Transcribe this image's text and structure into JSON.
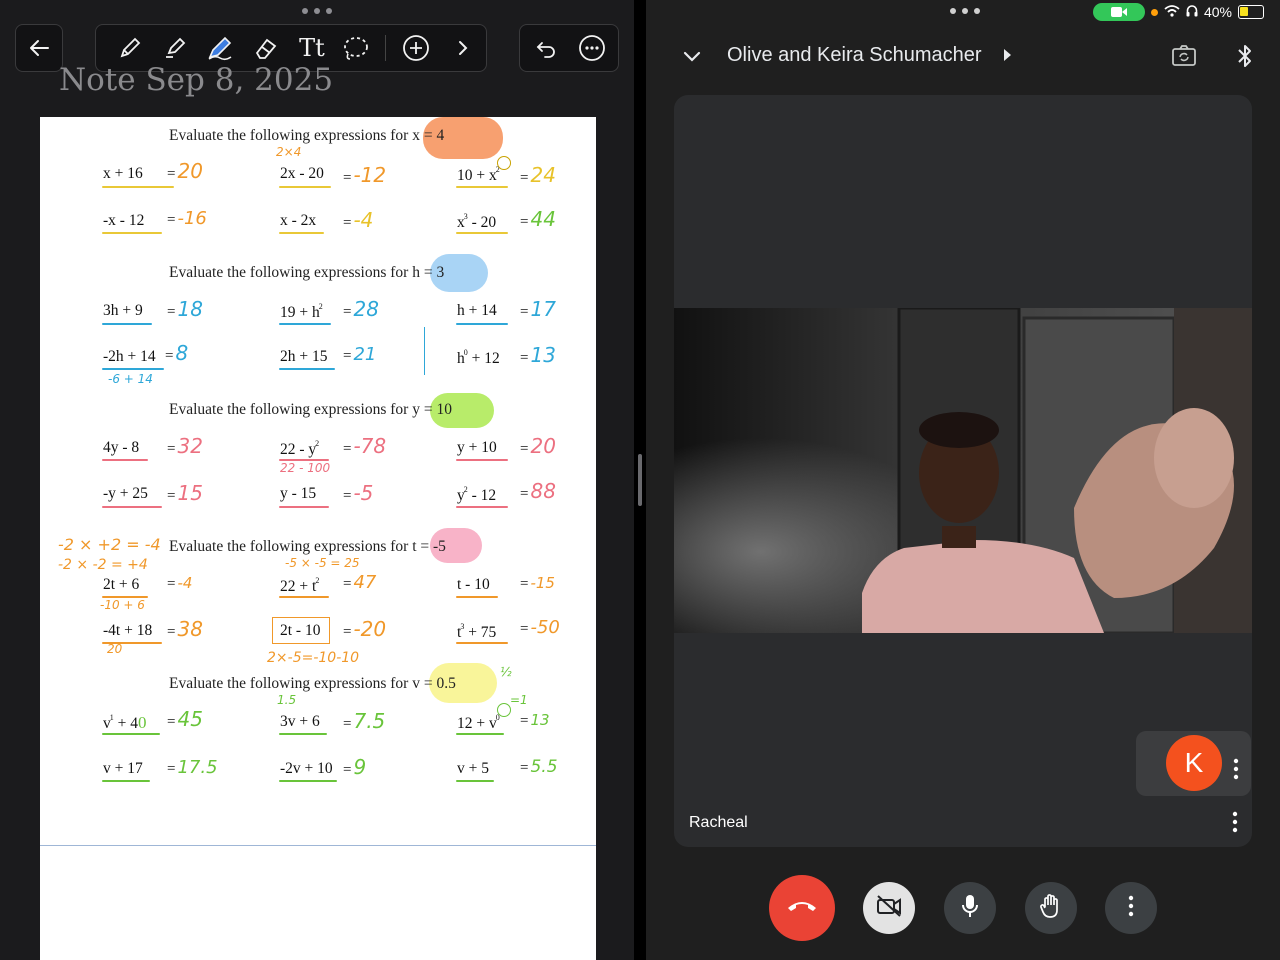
{
  "notes_app": {
    "note_title": "Note Sep 8, 2025",
    "toolbar": {
      "back_icon": "arrow-left-icon",
      "tools": [
        "pen-icon",
        "highlighter-icon",
        "pen-selected-icon",
        "eraser-icon",
        "text-icon",
        "lasso-icon",
        "add-icon",
        "chevron-right-icon"
      ],
      "text_tool_label": "Tt",
      "actions": [
        "undo-icon",
        "more-icon"
      ]
    },
    "worksheet": {
      "sections": [
        {
          "heading": "Evaluate the following expressions for ",
          "variable": "x = 4",
          "highlight": "#f7a070",
          "items": [
            {
              "expr": "x + 16",
              "sup": "",
              "answer": "20"
            },
            {
              "expr": "2x - 20",
              "sup": "",
              "answer": "-12"
            },
            {
              "expr": "10 + x",
              "sup": "2",
              "answer": "24"
            },
            {
              "expr": "-x - 12",
              "sup": "",
              "answer": "-16"
            },
            {
              "expr": "x - 2x",
              "sup": "",
              "answer": "-4"
            },
            {
              "expr": "x",
              "sup": "3",
              "expr_tail": " - 20",
              "answer": "44"
            }
          ]
        },
        {
          "heading": "Evaluate the following expressions for ",
          "variable": "h = 3",
          "highlight": "#a9d4f5",
          "items": [
            {
              "expr": "3h + 9",
              "sup": "",
              "answer": "18"
            },
            {
              "expr": "19 + h",
              "sup": "2",
              "answer": "28"
            },
            {
              "expr": "h + 14",
              "sup": "",
              "answer": "17"
            },
            {
              "expr": "-2h + 14",
              "sup": "",
              "answer": "8"
            },
            {
              "expr": "2h + 15",
              "sup": "",
              "answer": "21"
            },
            {
              "expr": "h",
              "sup": "0",
              "expr_tail": " + 12",
              "answer": "13"
            }
          ]
        },
        {
          "heading": "Evaluate the following expressions for ",
          "variable": "y = 10",
          "highlight": "#b8ec6a",
          "items": [
            {
              "expr": "4y - 8",
              "sup": "",
              "answer": "32"
            },
            {
              "expr": "22 - y",
              "sup": "2",
              "answer": "-78"
            },
            {
              "expr": "y + 10",
              "sup": "",
              "answer": "20"
            },
            {
              "expr": "-y + 25",
              "sup": "",
              "answer": "15"
            },
            {
              "expr": "y - 15",
              "sup": "",
              "answer": "-5"
            },
            {
              "expr": "y",
              "sup": "2",
              "expr_tail": " - 12",
              "answer": "88"
            }
          ]
        },
        {
          "heading": "Evaluate the following expressions for ",
          "variable": "t = -5",
          "highlight": "#f8b3c8",
          "items": [
            {
              "expr": "2t + 6",
              "sup": "",
              "answer": "-4"
            },
            {
              "expr": "22 + t",
              "sup": "2",
              "answer": "47"
            },
            {
              "expr": "t - 10",
              "sup": "",
              "answer": "-15"
            },
            {
              "expr": "-4t + 18",
              "sup": "",
              "answer": "38"
            },
            {
              "expr": "2t - 10",
              "sup": "",
              "answer": "-20"
            },
            {
              "expr": "t",
              "sup": "3",
              "expr_tail": " + 75",
              "answer": "-50"
            }
          ]
        },
        {
          "heading": "Evaluate the following expressions for ",
          "variable": "v = 0.5",
          "highlight": "#f9f59a",
          "items": [
            {
              "expr": "v",
              "sup": "1",
              "expr_tail": " + 4",
              "answer": "45"
            },
            {
              "expr": "3v + 6",
              "sup": "",
              "answer": "7.5"
            },
            {
              "expr": "12 + v",
              "sup": "0",
              "answer": "13"
            },
            {
              "expr": "v + 17",
              "sup": "",
              "answer": "17.5"
            },
            {
              "expr": "-2v + 10",
              "sup": "",
              "answer": "9"
            },
            {
              "expr": "v + 5",
              "sup": "",
              "answer": "5.5"
            }
          ]
        }
      ],
      "handwritten_notes": {
        "x_2x4": "2×4",
        "h_work": "-6 + 14",
        "y_work": "22 - 100",
        "t_work_a": "-2 × +2 = -4",
        "t_work_b": "-2 × -2 = +4",
        "t_work_c": "-10 + 6",
        "t_work_d": "-5 × -5 = 25",
        "t_work_e": "20",
        "t_work_f": "2×-5=-10-10",
        "v_work_a": "1.5",
        "v_work_b": "½",
        "v_work_c": "0",
        "v_work_d": "=1",
        "v_work_e": "0"
      }
    }
  },
  "meet_app": {
    "status": {
      "battery": "40%",
      "battery_level": 0.4
    },
    "call_title": "Olive and Keira Schumacher",
    "participant_name": "Racheal",
    "self_avatar_letter": "K",
    "colors": {
      "end_call": "#ea4335",
      "avatar": "#f4511e",
      "accent_green": "#33c759"
    },
    "controls": [
      "end-call-icon",
      "camera-off-icon",
      "mic-icon",
      "raise-hand-icon",
      "more-options-icon"
    ]
  }
}
